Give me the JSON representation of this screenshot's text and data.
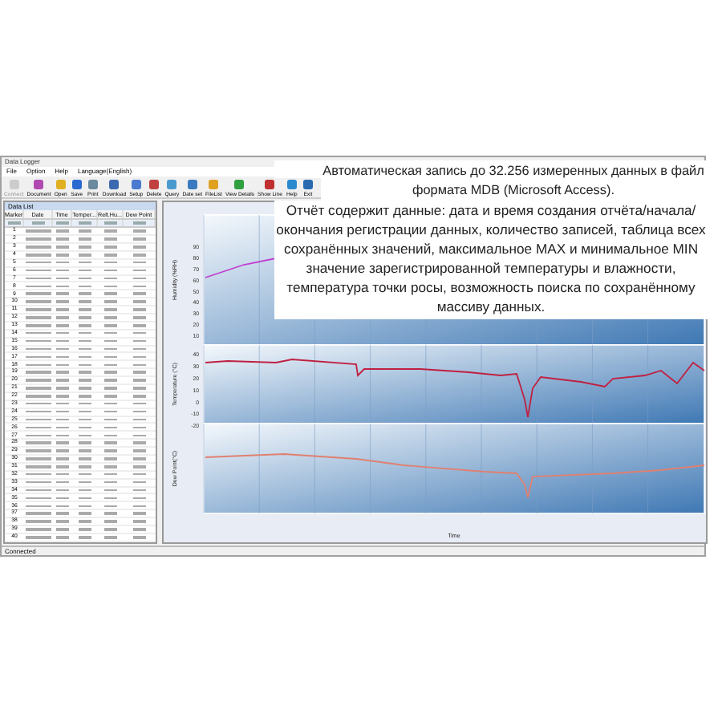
{
  "window": {
    "title": "Data Logger"
  },
  "menu": [
    "File",
    "Option",
    "Help",
    "Language(English)"
  ],
  "toolbar": [
    {
      "label": "Connect",
      "disabled": true
    },
    {
      "label": "Document",
      "disabled": false
    },
    {
      "label": "Open",
      "disabled": false
    },
    {
      "label": "Save",
      "disabled": false
    },
    {
      "label": "Print",
      "disabled": false
    },
    {
      "label": "Download",
      "disabled": false
    },
    {
      "label": "Setup",
      "disabled": false
    },
    {
      "label": "Delete",
      "disabled": false
    },
    {
      "label": "Query",
      "disabled": false
    },
    {
      "label": "Date set",
      "disabled": false
    },
    {
      "label": "FileList",
      "disabled": false
    },
    {
      "label": "View Details",
      "disabled": false
    },
    {
      "label": "Show Line",
      "disabled": false
    },
    {
      "label": "Help",
      "disabled": false
    },
    {
      "label": "Exit",
      "disabled": false
    }
  ],
  "data_list": {
    "title": "Data List",
    "columns": [
      "Marker",
      "Date",
      "Time",
      "Temper...",
      "Relt.Hu...",
      "Dew Point"
    ],
    "rows": [
      "1",
      "2",
      "3",
      "4",
      "5",
      "6",
      "7",
      "8",
      "9",
      "10",
      "11",
      "12",
      "13",
      "14",
      "15",
      "16",
      "17",
      "18",
      "19",
      "20",
      "21",
      "22",
      "23",
      "24",
      "25",
      "26",
      "27",
      "28",
      "29",
      "30",
      "31",
      "32",
      "33",
      "34",
      "35",
      "36",
      "37",
      "38",
      "39",
      "40"
    ]
  },
  "charts": [
    {
      "ylabel": "Humidity (%RH)",
      "yticks": [
        "90",
        "80",
        "70",
        "60",
        "50",
        "40",
        "30",
        "20",
        "10"
      ]
    },
    {
      "ylabel": "Temperature (°C)",
      "yticks": [
        "40",
        "30",
        "20",
        "10",
        "0",
        "-10",
        "-20"
      ]
    },
    {
      "ylabel": "Dew Point(°C)"
    }
  ],
  "xlabel": "Time",
  "status_bar": "Connected",
  "overlay_text": [
    "Автоматическая запись до 32.256 измеренных данных в файл формата MDB (Microsoft Access).",
    "Отчёт содержит данные: дата и время создания отчёта/начала/окончания регистрации данных, количество записей, таблица всех сохранённых значений, максимальное MAX и минимальное MIN значение зарегистрированной температуры и влажности, температура точки росы, возможность поиска по сохранённому массиву данных."
  ]
}
